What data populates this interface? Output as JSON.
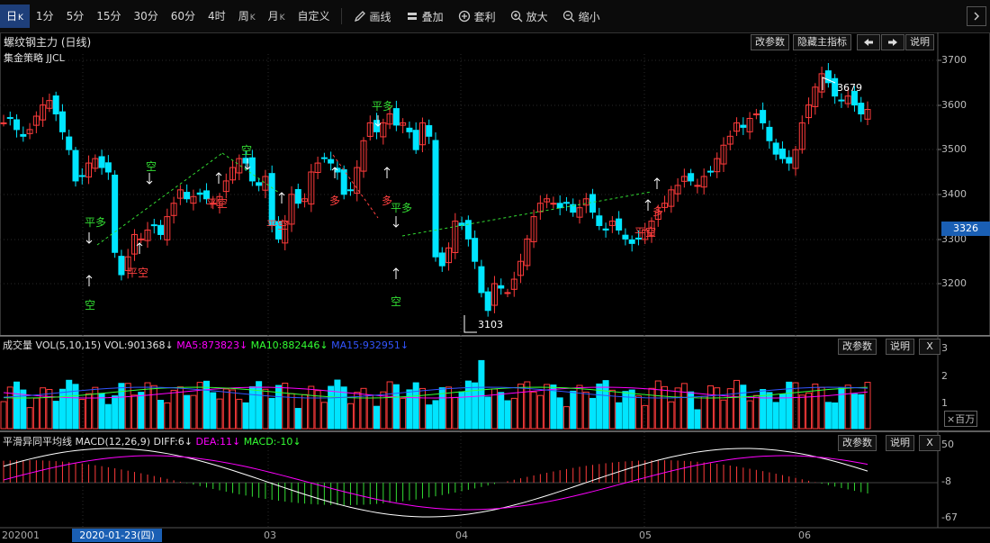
{
  "toolbar": {
    "periods": [
      "日K",
      "1分",
      "5分",
      "15分",
      "30分",
      "60分",
      "4时",
      "周K",
      "月K",
      "自定义"
    ],
    "active_period": "日K",
    "tools": {
      "draw": "画线",
      "overlay": "叠加",
      "arbitrage": "套利",
      "zoom_in": "放大",
      "zoom_out": "缩小"
    }
  },
  "main_panel": {
    "title": "螺纹钢主力 (日线)",
    "strategy": "集金策略 JJCL",
    "buttons": {
      "params": "改参数",
      "hide": "隐藏主指标",
      "help": "说明"
    },
    "current_price": "3326",
    "high_label": "3679",
    "low_label": "3103",
    "y_ticks": [
      "3700",
      "3600",
      "3500",
      "3400",
      "3300",
      "3200"
    ]
  },
  "vol_panel": {
    "name": "成交量",
    "indicator": "VOL(5,10,15)",
    "vol": "VOL:901368",
    "ma5": "MA5:873823",
    "ma10": "MA10:882446",
    "ma15": "MA15:932951",
    "buttons": {
      "params": "改参数",
      "help": "说明",
      "close": "X"
    },
    "y_ticks": [
      "3",
      "2",
      "1"
    ],
    "unit": "×百万"
  },
  "macd_panel": {
    "name": "平滑异同平均线",
    "indicator": "MACD(12,26,9)",
    "diff": "DIFF:6",
    "dea": "DEA:11",
    "macd": "MACD:-10",
    "buttons": {
      "params": "改参数",
      "help": "说明",
      "close": "X"
    },
    "y_ticks": [
      "50",
      "-8",
      "-67"
    ]
  },
  "xaxis": {
    "start": "202001",
    "selected_date": "2020-01-23(四)",
    "months": [
      "03",
      "04",
      "05",
      "06"
    ]
  },
  "annotations": {
    "kong": "空",
    "ping_duo": "平多",
    "ping_kong": "平空",
    "duo": "多",
    "ping_kong_alt": "平空",
    "ping_duo_alt": "平多"
  },
  "colors": {
    "up": "#ff3b3b",
    "down": "#00e5ff",
    "signal_green": "#33dd33",
    "signal_red": "#ff4040",
    "ma5": "#ff00ff",
    "ma10": "#33ff33",
    "ma15": "#3355ff"
  }
}
